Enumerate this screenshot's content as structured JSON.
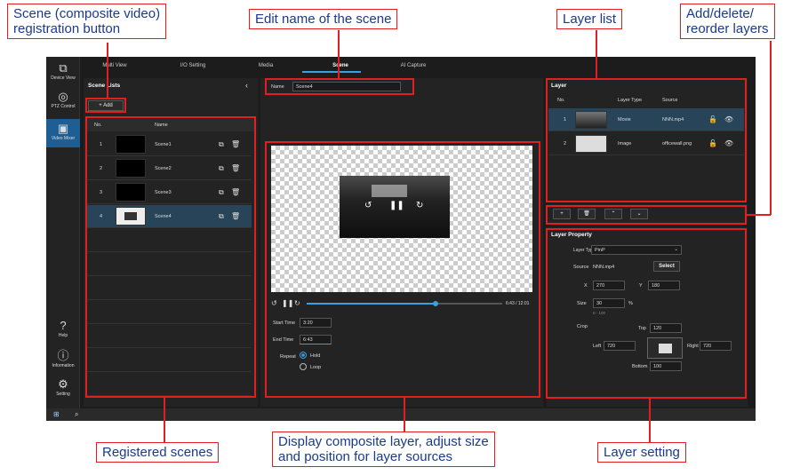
{
  "callouts": {
    "scene_reg_line1": "Scene (composite video)",
    "scene_reg_line2": "registration button",
    "edit_name": "Edit name of the scene",
    "layer_list": "Layer list",
    "add_del_line1": "Add/delete/",
    "add_del_line2": "reorder layers",
    "registered": "Registered scenes",
    "display_line1": "Display composite layer, adjust size",
    "display_line2": "and position for layer sources",
    "layer_setting": "Layer setting"
  },
  "nav": {
    "device_view": "Device View",
    "ptz_control": "PTZ Control",
    "video_mixer": "Video Mixer",
    "help": "Help",
    "information": "Information",
    "setting": "Setting"
  },
  "tabs": [
    "Multi View",
    "I/O Setting",
    "Media",
    "Scene",
    "AI Capture"
  ],
  "scene_list": {
    "title": "Scene Lists",
    "add_label": "Add",
    "col_no": "No.",
    "col_name": "Name",
    "rows": [
      {
        "no": "1",
        "name": "Scene1"
      },
      {
        "no": "2",
        "name": "Scene2"
      },
      {
        "no": "3",
        "name": "Scene3"
      },
      {
        "no": "4",
        "name": "Scene4"
      }
    ]
  },
  "scene_name": {
    "label": "Name",
    "value": "Scene4"
  },
  "playback": {
    "time": "6:43 / 12:01",
    "progress": 0.66
  },
  "timing": {
    "start_label": "Start Time",
    "start_value": "3:20",
    "end_label": "End Time",
    "end_value": "6:43",
    "repeat_label": "Repeat",
    "hold": "Hold",
    "loop": "Loop"
  },
  "layer": {
    "title": "Layer",
    "col_no": "No.",
    "col_type": "Layer Type",
    "col_source": "Source",
    "rows": [
      {
        "no": "1",
        "type": "Movie",
        "source": "NNN.mp4"
      },
      {
        "no": "2",
        "type": "Image",
        "source": "officewall.png"
      }
    ]
  },
  "layer_property": {
    "title": "Layer Property",
    "type_label": "Layer Type",
    "type_value": "PinP",
    "source_label": "Source",
    "source_value": "NNN.mp4",
    "select_label": "Select",
    "x_label": "X",
    "x_value": "270",
    "y_label": "Y",
    "y_value": "180",
    "size_label": "Size",
    "size_value": "30",
    "size_unit": "%",
    "size_range": "0 - 100",
    "crop_label": "Crop",
    "top_label": "Top",
    "top_value": "120",
    "left_label": "Left",
    "left_value": "720",
    "right_label": "Right",
    "right_value": "720",
    "bottom_label": "Bottom",
    "bottom_value": "100"
  }
}
